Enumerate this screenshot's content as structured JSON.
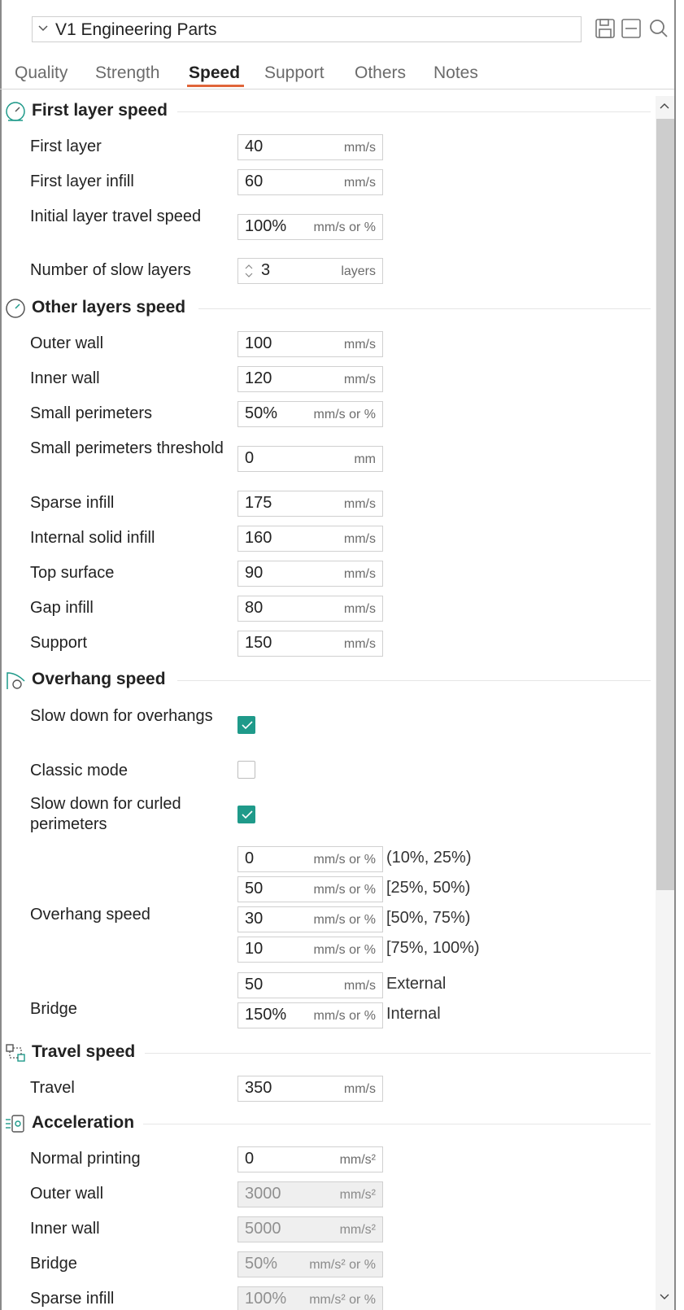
{
  "preset": {
    "name": "V1 Engineering Parts"
  },
  "header_icons": [
    "save-icon",
    "minimize-icon",
    "search-icon"
  ],
  "tabs": [
    {
      "label": "Quality"
    },
    {
      "label": "Strength"
    },
    {
      "label": "Speed",
      "active": true
    },
    {
      "label": "Support"
    },
    {
      "label": "Others"
    },
    {
      "label": "Notes"
    }
  ],
  "accent_color": "#e0653a",
  "checkbox_color": "#1f9a8a",
  "sections": {
    "first_layer": {
      "title": "First layer speed",
      "first_layer": {
        "label": "First layer",
        "value": "40",
        "unit": "mm/s"
      },
      "first_layer_infill": {
        "label": "First layer infill",
        "value": "60",
        "unit": "mm/s"
      },
      "initial_travel": {
        "label": "Initial layer travel speed",
        "value": "100%",
        "unit": "mm/s or %"
      },
      "slow_layers": {
        "label": "Number of slow layers",
        "value": "3",
        "unit": "layers"
      }
    },
    "other_layers": {
      "title": "Other layers speed",
      "outer_wall": {
        "label": "Outer wall",
        "value": "100",
        "unit": "mm/s"
      },
      "inner_wall": {
        "label": "Inner wall",
        "value": "120",
        "unit": "mm/s"
      },
      "small_perimeters": {
        "label": "Small perimeters",
        "value": "50%",
        "unit": "mm/s or %"
      },
      "small_perimeters_threshold": {
        "label": "Small perimeters threshold",
        "value": "0",
        "unit": "mm"
      },
      "sparse_infill": {
        "label": "Sparse infill",
        "value": "175",
        "unit": "mm/s"
      },
      "internal_solid_infill": {
        "label": "Internal solid infill",
        "value": "160",
        "unit": "mm/s"
      },
      "top_surface": {
        "label": "Top surface",
        "value": "90",
        "unit": "mm/s"
      },
      "gap_infill": {
        "label": "Gap infill",
        "value": "80",
        "unit": "mm/s"
      },
      "support": {
        "label": "Support",
        "value": "150",
        "unit": "mm/s"
      }
    },
    "overhang": {
      "title": "Overhang speed",
      "slow_down_overhangs": {
        "label": "Slow down for overhangs",
        "checked": true
      },
      "classic_mode": {
        "label": "Classic mode",
        "checked": false
      },
      "slow_down_curled": {
        "label": "Slow down for curled perimeters",
        "checked": true
      },
      "overhang_speed": {
        "label": "Overhang speed",
        "rows": [
          {
            "value": "0",
            "unit": "mm/s or %",
            "range": "(10%, 25%)"
          },
          {
            "value": "50",
            "unit": "mm/s or %",
            "range": "[25%, 50%)"
          },
          {
            "value": "30",
            "unit": "mm/s or %",
            "range": "[50%, 75%)"
          },
          {
            "value": "10",
            "unit": "mm/s or %",
            "range": "[75%, 100%)"
          }
        ]
      },
      "bridge": {
        "label": "Bridge",
        "external": {
          "value": "50",
          "unit": "mm/s",
          "tag": "External"
        },
        "internal": {
          "value": "150%",
          "unit": "mm/s or %",
          "tag": "Internal"
        }
      }
    },
    "travel": {
      "title": "Travel speed",
      "travel": {
        "label": "Travel",
        "value": "350",
        "unit": "mm/s"
      }
    },
    "acceleration": {
      "title": "Acceleration",
      "normal_printing": {
        "label": "Normal printing",
        "value": "0",
        "unit": "mm/s²"
      },
      "outer_wall": {
        "label": "Outer wall",
        "value": "3000",
        "unit": "mm/s²"
      },
      "inner_wall": {
        "label": "Inner wall",
        "value": "5000",
        "unit": "mm/s²"
      },
      "bridge": {
        "label": "Bridge",
        "value": "50%",
        "unit": "mm/s² or %"
      },
      "sparse_infill": {
        "label": "Sparse infill",
        "value": "100%",
        "unit": "mm/s² or %"
      }
    }
  }
}
